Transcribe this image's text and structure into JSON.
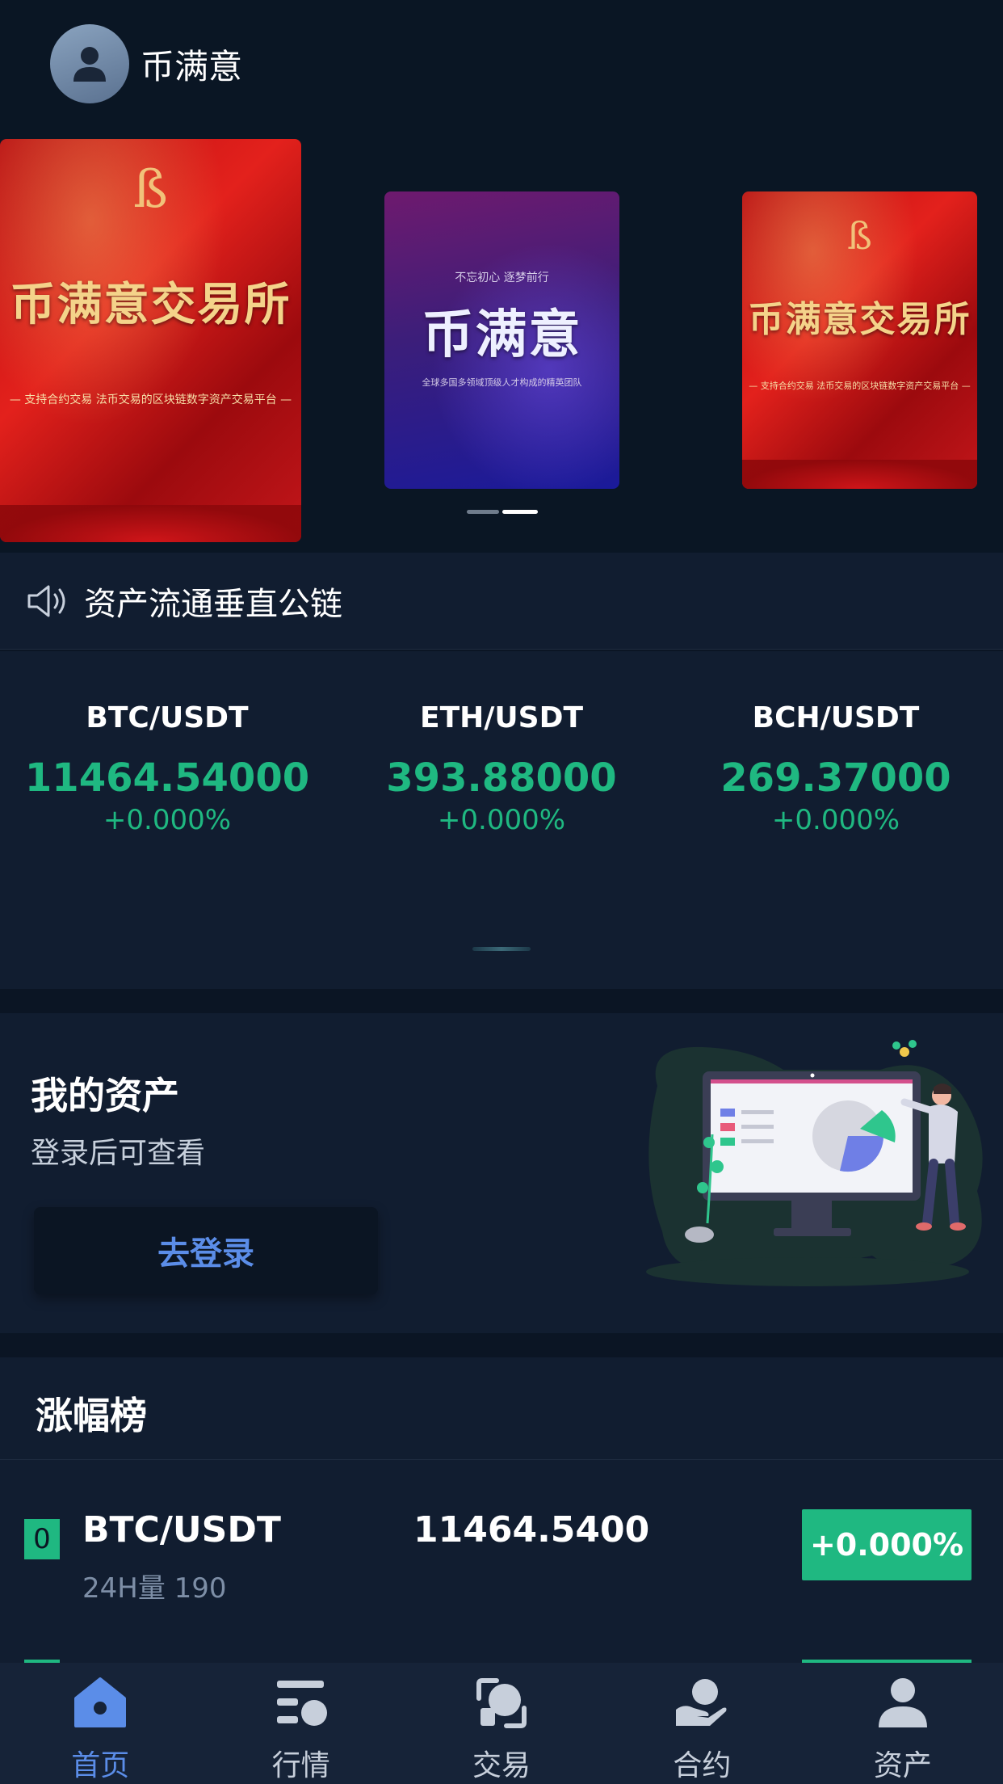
{
  "header": {
    "app_name": "币满意"
  },
  "banners": [
    {
      "title": "币满意交易所",
      "subtitle": "— 支持合约交易 法币交易的区块链数字资产交易平台 —"
    },
    {
      "tagline": "不忘初心  逐梦前行",
      "title": "币满意",
      "subtitle": "全球多国多领域顶级人才构成的精英团队"
    },
    {
      "title": "币满意交易所",
      "subtitle": "— 支持合约交易 法币交易的区块链数字资产交易平台 —"
    }
  ],
  "notice": {
    "text": "资产流通垂直公链"
  },
  "tickers": [
    {
      "pair": "BTC/USDT",
      "price": "11464.54000",
      "change": "+0.000%"
    },
    {
      "pair": "ETH/USDT",
      "price": "393.88000",
      "change": "+0.000%"
    },
    {
      "pair": "BCH/USDT",
      "price": "269.37000",
      "change": "+0.000%"
    }
  ],
  "assets": {
    "title": "我的资产",
    "subtitle": "登录后可查看",
    "login_label": "去登录"
  },
  "gainers": {
    "title": "涨幅榜",
    "rows": [
      {
        "rank": "0",
        "pair": "BTC/USDT",
        "volume": "24H量 190",
        "price": "11464.5400",
        "change": "+0.000%"
      }
    ]
  },
  "tabbar": [
    {
      "label": "首页",
      "icon": "home-icon",
      "active": true
    },
    {
      "label": "行情",
      "icon": "market-icon",
      "active": false
    },
    {
      "label": "交易",
      "icon": "trade-icon",
      "active": false
    },
    {
      "label": "合约",
      "icon": "contract-icon",
      "active": false
    },
    {
      "label": "资产",
      "icon": "user-icon",
      "active": false
    }
  ],
  "colors": {
    "accent": "#5b8de8",
    "up": "#1fb881",
    "panel": "#111d30",
    "background": "#0b1524"
  }
}
